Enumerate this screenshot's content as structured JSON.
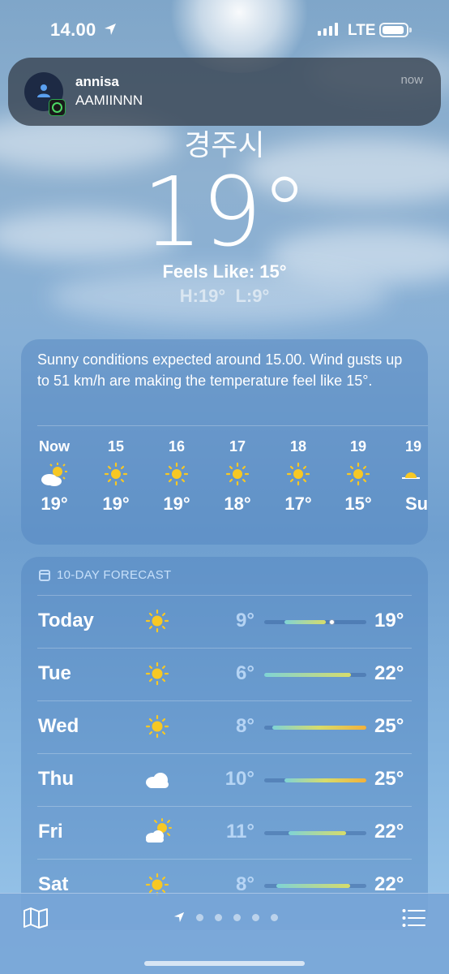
{
  "status_bar": {
    "time": "14.00",
    "network": "LTE"
  },
  "notification": {
    "sender": "annisa",
    "message": "AAMIINNN",
    "time": "now"
  },
  "current": {
    "city": "경주시",
    "temperature": "19°",
    "feels_like": "Feels Like: 15°",
    "high": "H:19°",
    "low": "L:9°"
  },
  "hourly": {
    "summary": "Sunny conditions expected around 15.00. Wind gusts up to 51 km/h are making the temperature feel like 15°.",
    "items": [
      {
        "label": "Now",
        "icon": "partly-sunny-icon",
        "temp": "19°"
      },
      {
        "label": "15",
        "icon": "sun-icon",
        "temp": "19°"
      },
      {
        "label": "16",
        "icon": "sun-icon",
        "temp": "19°"
      },
      {
        "label": "17",
        "icon": "sun-icon",
        "temp": "18°"
      },
      {
        "label": "18",
        "icon": "sun-icon",
        "temp": "17°"
      },
      {
        "label": "19",
        "icon": "sun-icon",
        "temp": "15°"
      },
      {
        "label": "19",
        "icon": "sunset-icon",
        "temp": "Su"
      }
    ]
  },
  "daily": {
    "header": "10-DAY FORECAST",
    "days": [
      {
        "day": "Today",
        "icon": "sun-icon",
        "low": "9°",
        "high": "19°",
        "range_start": 0.2,
        "range_end": 0.6,
        "current_marker": 0.66
      },
      {
        "day": "Tue",
        "icon": "sun-icon",
        "low": "6°",
        "high": "22°",
        "range_start": 0.0,
        "range_end": 0.85
      },
      {
        "day": "Wed",
        "icon": "sun-icon",
        "low": "8°",
        "high": "25°",
        "range_start": 0.08,
        "range_end": 1.0
      },
      {
        "day": "Thu",
        "icon": "cloud-icon",
        "low": "10°",
        "high": "25°",
        "range_start": 0.2,
        "range_end": 1.0
      },
      {
        "day": "Fri",
        "icon": "partly-sunny-icon",
        "low": "11°",
        "high": "22°",
        "range_start": 0.24,
        "range_end": 0.8
      },
      {
        "day": "Sat",
        "icon": "sun-icon",
        "low": "8°",
        "high": "22°",
        "range_start": 0.12,
        "range_end": 0.84
      }
    ]
  },
  "colors": {
    "sun": "#f7c824",
    "bar_cool": "#7fd3d6",
    "bar_mid": "#d7dc6a",
    "bar_warm": "#f2b13b"
  }
}
